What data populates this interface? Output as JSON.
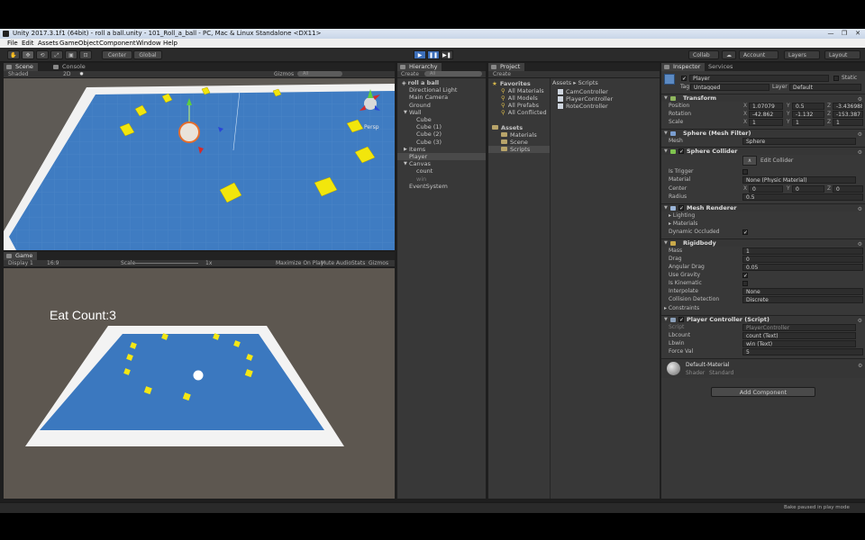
{
  "window": {
    "title": "Unity 2017.3.1f1 (64bit) - roll a ball.unity - 101_Roll_a_ball - PC, Mac & Linux Standalone <DX11>",
    "controls": [
      "—",
      "❐",
      "✕"
    ]
  },
  "menu": [
    "File",
    "Edit",
    "Assets",
    "GameObject",
    "Component",
    "Window",
    "Help"
  ],
  "toolbar": {
    "tools": [
      "✋",
      "✥",
      "⟲",
      "⤢",
      "▣",
      "⊡"
    ],
    "pivot": "Center",
    "space": "Global",
    "play": [
      "▶",
      "❚❚",
      "▶❚"
    ],
    "collab": "Collab",
    "cloud": "☁",
    "account": "Account",
    "layers": "Layers",
    "layout": "Layout"
  },
  "scene": {
    "tabs": [
      "Scene",
      "Console"
    ],
    "shading": "Shaded",
    "mode2d": "2D",
    "gizmos": "Gizmos",
    "search": "All",
    "persp": "Persp"
  },
  "game": {
    "tab": "Game",
    "display": "Display 1",
    "aspect": "16:9",
    "scale_label": "Scale",
    "scale_value": "1x",
    "options": [
      "Maximize On Play",
      "Mute Audio",
      "Stats",
      "Gizmos"
    ],
    "hud": "Eat Count:3"
  },
  "hierarchy": {
    "tab": "Hierarchy",
    "create": "Create",
    "search": "All",
    "items": [
      {
        "label": "roll a ball",
        "indent": 0,
        "kind": "scene"
      },
      {
        "label": "Directional Light",
        "indent": 1
      },
      {
        "label": "Main Camera",
        "indent": 1
      },
      {
        "label": "Ground",
        "indent": 1
      },
      {
        "label": "Wall",
        "indent": 1,
        "fold": "▼"
      },
      {
        "label": "Cube",
        "indent": 2
      },
      {
        "label": "Cube (1)",
        "indent": 2
      },
      {
        "label": "Cube (2)",
        "indent": 2
      },
      {
        "label": "Cube (3)",
        "indent": 2
      },
      {
        "label": "Items",
        "indent": 1,
        "fold": "▶"
      },
      {
        "label": "Player",
        "indent": 1,
        "selected": true
      },
      {
        "label": "Canvas",
        "indent": 1,
        "fold": "▼"
      },
      {
        "label": "count",
        "indent": 2
      },
      {
        "label": "win",
        "indent": 2,
        "dim": true
      },
      {
        "label": "EventSystem",
        "indent": 1
      }
    ]
  },
  "project": {
    "tab": "Project",
    "create": "Create",
    "favorites_title": "Favorites",
    "favorites": [
      "All Materials",
      "All Models",
      "All Prefabs",
      "All Conflicted"
    ],
    "assets_title": "Assets",
    "assets": [
      "Materials",
      "Scene",
      "Scripts"
    ],
    "breadcrumb": [
      "Assets",
      "Scripts"
    ],
    "files": [
      "CamController",
      "PlayerController",
      "RoteController"
    ]
  },
  "inspector": {
    "tabs": [
      "Inspector",
      "Services"
    ],
    "object_name": "Player",
    "static": "Static",
    "tag_label": "Tag",
    "tag": "Untagged",
    "layer_label": "Layer",
    "layer": "Default",
    "transform": {
      "title": "Transform",
      "rows": [
        {
          "label": "Position",
          "x": "1.07079",
          "y": "0.5",
          "z": "-3.436988"
        },
        {
          "label": "Rotation",
          "x": "-42.862",
          "y": "-1.132",
          "z": "-153.387"
        },
        {
          "label": "Scale",
          "x": "1",
          "y": "1",
          "z": "1"
        }
      ]
    },
    "mesh_filter": {
      "title": "Sphere (Mesh Filter)",
      "mesh_label": "Mesh",
      "mesh": "Sphere"
    },
    "sphere_collider": {
      "title": "Sphere Collider",
      "edit": "Edit Collider",
      "is_trigger": "Is Trigger",
      "material_label": "Material",
      "material": "None (Physic Material)",
      "center_label": "Center",
      "center": {
        "x": "0",
        "y": "0",
        "z": "0"
      },
      "radius_label": "Radius",
      "radius": "0.5"
    },
    "mesh_renderer": {
      "title": "Mesh Renderer",
      "lighting": "Lighting",
      "materials": "Materials",
      "dyn": "Dynamic Occluded"
    },
    "rigidbody": {
      "title": "Rigidbody",
      "rows": [
        {
          "label": "Mass",
          "value": "1"
        },
        {
          "label": "Drag",
          "value": "0"
        },
        {
          "label": "Angular Drag",
          "value": "0.05"
        }
      ],
      "use_gravity": "Use Gravity",
      "is_kinematic": "Is Kinematic",
      "interpolate_label": "Interpolate",
      "interpolate": "None",
      "collision_label": "Collision Detection",
      "collision": "Discrete",
      "constraints": "Constraints"
    },
    "player_controller": {
      "title": "Player Controller (Script)",
      "script_label": "Script",
      "script": "PlayerController",
      "lbcount_label": "Lbcount",
      "lbcount": "count (Text)",
      "lbwin_label": "Lbwin",
      "lbwin": "win (Text)",
      "force_label": "Force Val",
      "force": "5"
    },
    "material": {
      "name": "Default-Material",
      "shader_label": "Shader",
      "shader": "Standard"
    },
    "add_component": "Add Component"
  },
  "status": {
    "text": "Bake paused in play mode"
  },
  "colors": {
    "accent": "#3d6fb9",
    "floor": "#3f7cc2",
    "cube": "#f2e60c",
    "editor_bg": "#383838"
  }
}
